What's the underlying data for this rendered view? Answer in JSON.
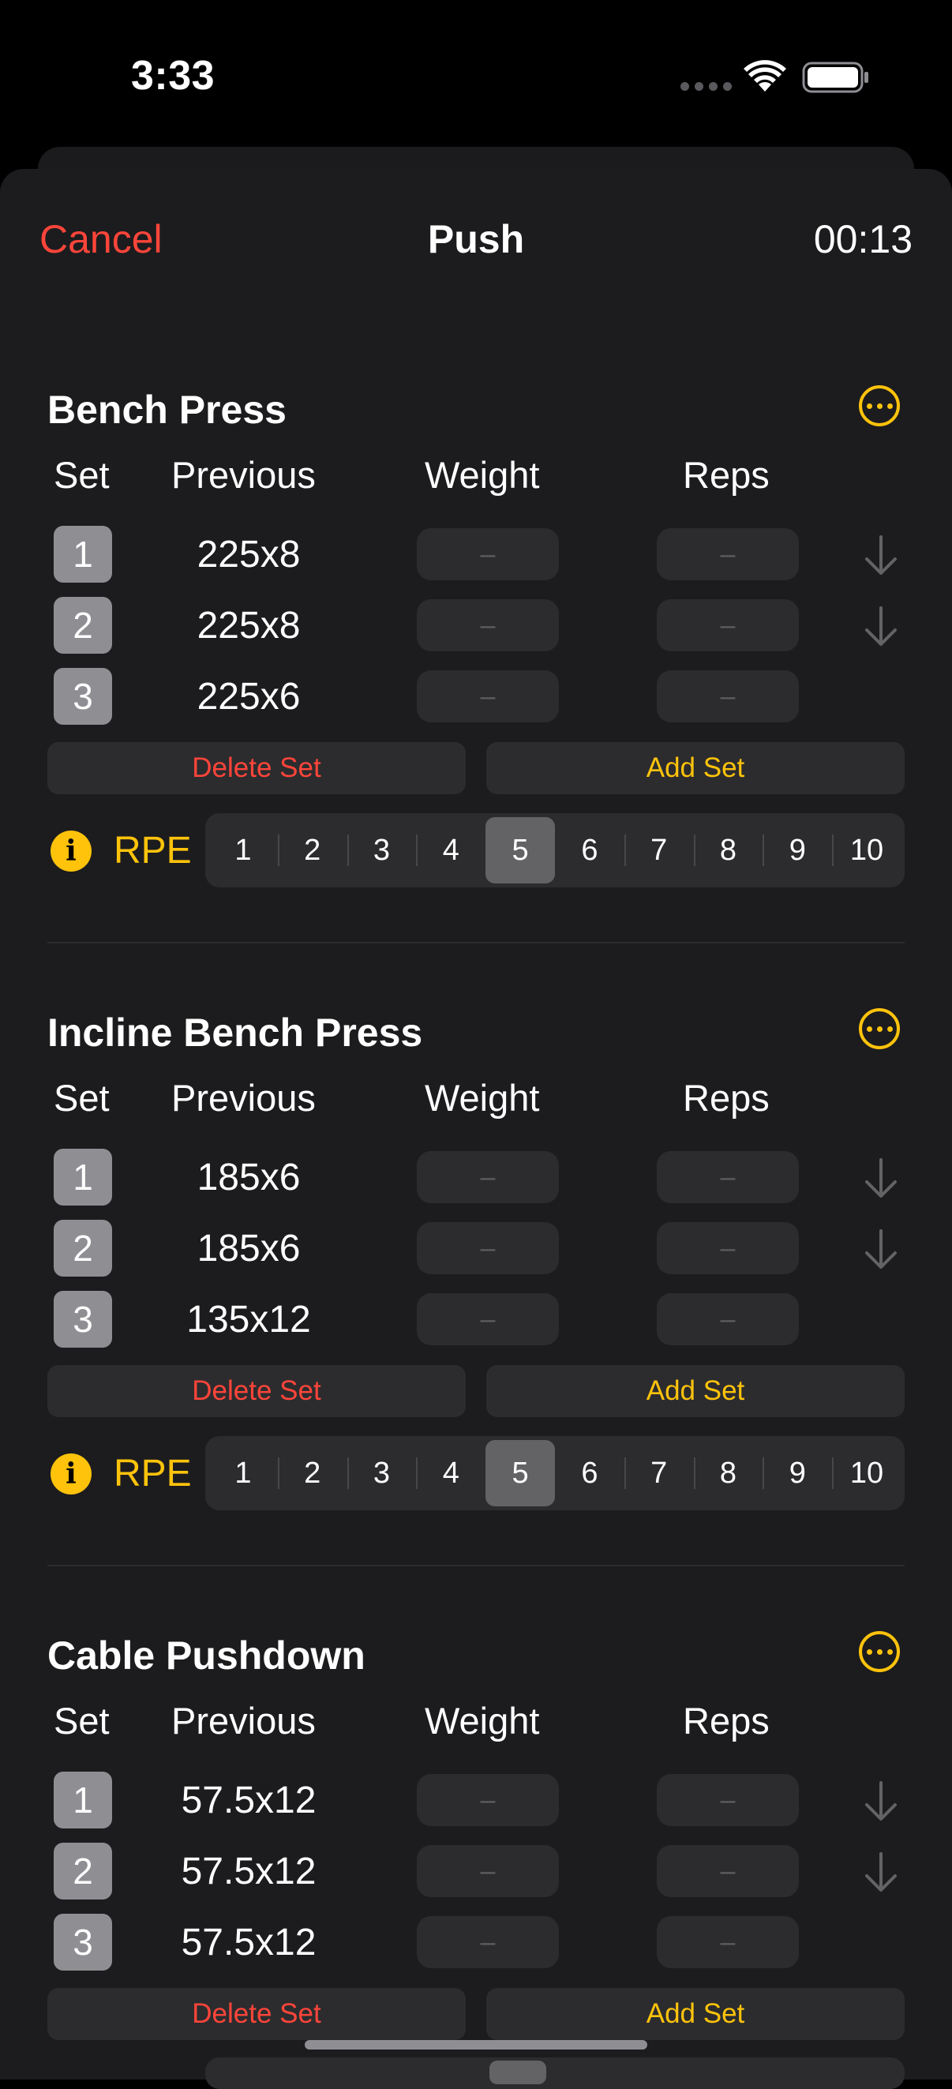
{
  "status": {
    "time": "3:33"
  },
  "nav": {
    "cancel_label": "Cancel",
    "title": "Push",
    "timer": "00:13"
  },
  "columns": {
    "set": "Set",
    "previous": "Previous",
    "weight": "Weight",
    "reps": "Reps"
  },
  "field_placeholder": "–",
  "buttons": {
    "delete_set": "Delete Set",
    "add_set": "Add Set"
  },
  "rpe": {
    "label": "RPE",
    "info_glyph": "i",
    "options": [
      "1",
      "2",
      "3",
      "4",
      "5",
      "6",
      "7",
      "8",
      "9",
      "10"
    ]
  },
  "exercises": [
    {
      "name": "Bench Press",
      "selected_rpe": "5",
      "sets": [
        {
          "num": "1",
          "previous": "225x8"
        },
        {
          "num": "2",
          "previous": "225x8"
        },
        {
          "num": "3",
          "previous": "225x6"
        }
      ]
    },
    {
      "name": "Incline Bench Press",
      "selected_rpe": "5",
      "sets": [
        {
          "num": "1",
          "previous": "185x6"
        },
        {
          "num": "2",
          "previous": "185x6"
        },
        {
          "num": "3",
          "previous": "135x12"
        }
      ]
    },
    {
      "name": "Cable Pushdown",
      "selected_rpe": "5",
      "sets": [
        {
          "num": "1",
          "previous": "57.5x12"
        },
        {
          "num": "2",
          "previous": "57.5x12"
        },
        {
          "num": "3",
          "previous": "57.5x12"
        }
      ]
    }
  ],
  "icons": {
    "more": "ellipsis-circle-icon",
    "down_arrow": "arrow-down-icon",
    "info": "info-circle-icon"
  },
  "colors": {
    "accent": "#ffc30b",
    "destructive": "#ff453a",
    "sheet_bg": "#1c1c1e",
    "field_bg": "#2c2c2e",
    "set_badge": "#8e8e93"
  }
}
